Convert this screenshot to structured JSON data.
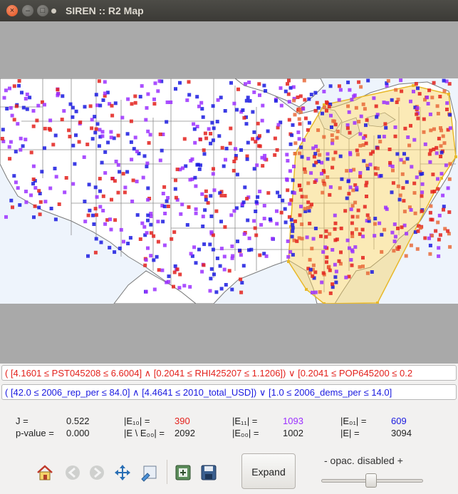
{
  "window": {
    "title": "SIREN :: R2 Map",
    "close_icon": "×",
    "min_icon": "–",
    "max_icon": "□"
  },
  "colors": {
    "left": "#e3211c",
    "right": "#1a1ae0",
    "both": "#9b30ff",
    "hull": "#f7d05e",
    "ocean": "#eef4fc",
    "land": "#ffffff",
    "frame": "#a9a9a9"
  },
  "rules": {
    "left": "( [4.1601 ≤ PST045208 ≤ 6.6004] ∧  [0.2041 ≤ RHI425207 ≤ 1.1206]) ∨  [0.2041 ≤ POP645200 ≤ 0.2",
    "right": "( [42.0 ≤ 2006_rep_per ≤ 84.0] ∧  [4.4641 ≤ 2010_total_USD]) ∨  [1.0 ≤ 2006_dems_per ≤ 14.0]"
  },
  "stats": {
    "j_label": "J =",
    "j_value": "0.522",
    "p_label": "p-value =",
    "p_value": "0.000",
    "e10_label": "|E₁₀| =",
    "e10_value": "390",
    "e11_label": "|E₁₁| =",
    "e11_value": "1093",
    "e01_label": "|E₀₁| =",
    "e01_value": "609",
    "ediff_label": "|E \\ E₀₀| =",
    "ediff_value": "2092",
    "e00_label": "|E₀₀| =",
    "e00_value": "1002",
    "e_label": "|E| =",
    "e_value": "3094"
  },
  "toolbar": {
    "icons": [
      "home-icon",
      "back-icon",
      "forward-icon",
      "pan-icon",
      "zoom-icon",
      "configure-icon",
      "save-icon"
    ],
    "expand_label": "Expand",
    "opacity_label": "-  opac. disabled  +",
    "opacity_fraction": 0.49
  }
}
